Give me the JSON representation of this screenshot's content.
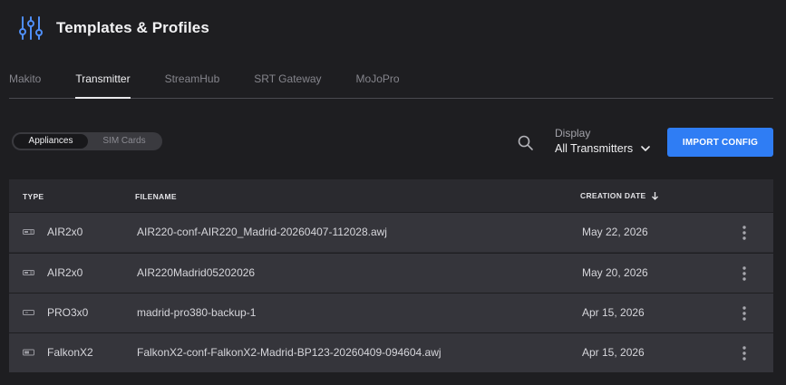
{
  "app": {
    "title": "Templates & Profiles",
    "logo_icon": "sliders-icon",
    "accent_color": "#4f8ef7"
  },
  "tabs": [
    {
      "label": "Makito",
      "active": false
    },
    {
      "label": "Transmitter",
      "active": true
    },
    {
      "label": "StreamHub",
      "active": false
    },
    {
      "label": "SRT Gateway",
      "active": false
    },
    {
      "label": "MoJoPro",
      "active": false
    }
  ],
  "toggle": {
    "options": [
      "Appliances",
      "SIM Cards"
    ],
    "selected": "Appliances"
  },
  "toolbar": {
    "search_icon": "search-icon",
    "display_label": "Display",
    "display_value": "All Transmitters",
    "import_label": "IMPORT CONFIG",
    "import_color": "#2f7df4"
  },
  "table": {
    "headers": {
      "type": "TYPE",
      "filename": "FILENAME",
      "creation_date": "CREATION DATE"
    },
    "sort": {
      "column": "creation_date",
      "direction": "descending"
    },
    "rows": [
      {
        "type": "AIR2x0",
        "icon": "air-device-icon",
        "filename": "AIR220-conf-AIR220_Madrid-20260407-112028.awj",
        "date": "May 22, 2026"
      },
      {
        "type": "AIR2x0",
        "icon": "air-device-icon",
        "filename": "AIR220Madrid05202026",
        "date": "May 20, 2026"
      },
      {
        "type": "PRO3x0",
        "icon": "pro-device-icon",
        "filename": "madrid-pro380-backup-1",
        "date": "Apr 15, 2026"
      },
      {
        "type": "FalkonX2",
        "icon": "falkon-device-icon",
        "filename": "FalkonX2-conf-FalkonX2-Madrid-BP123-20260409-094604.awj",
        "date": "Apr 15, 2026"
      }
    ]
  }
}
